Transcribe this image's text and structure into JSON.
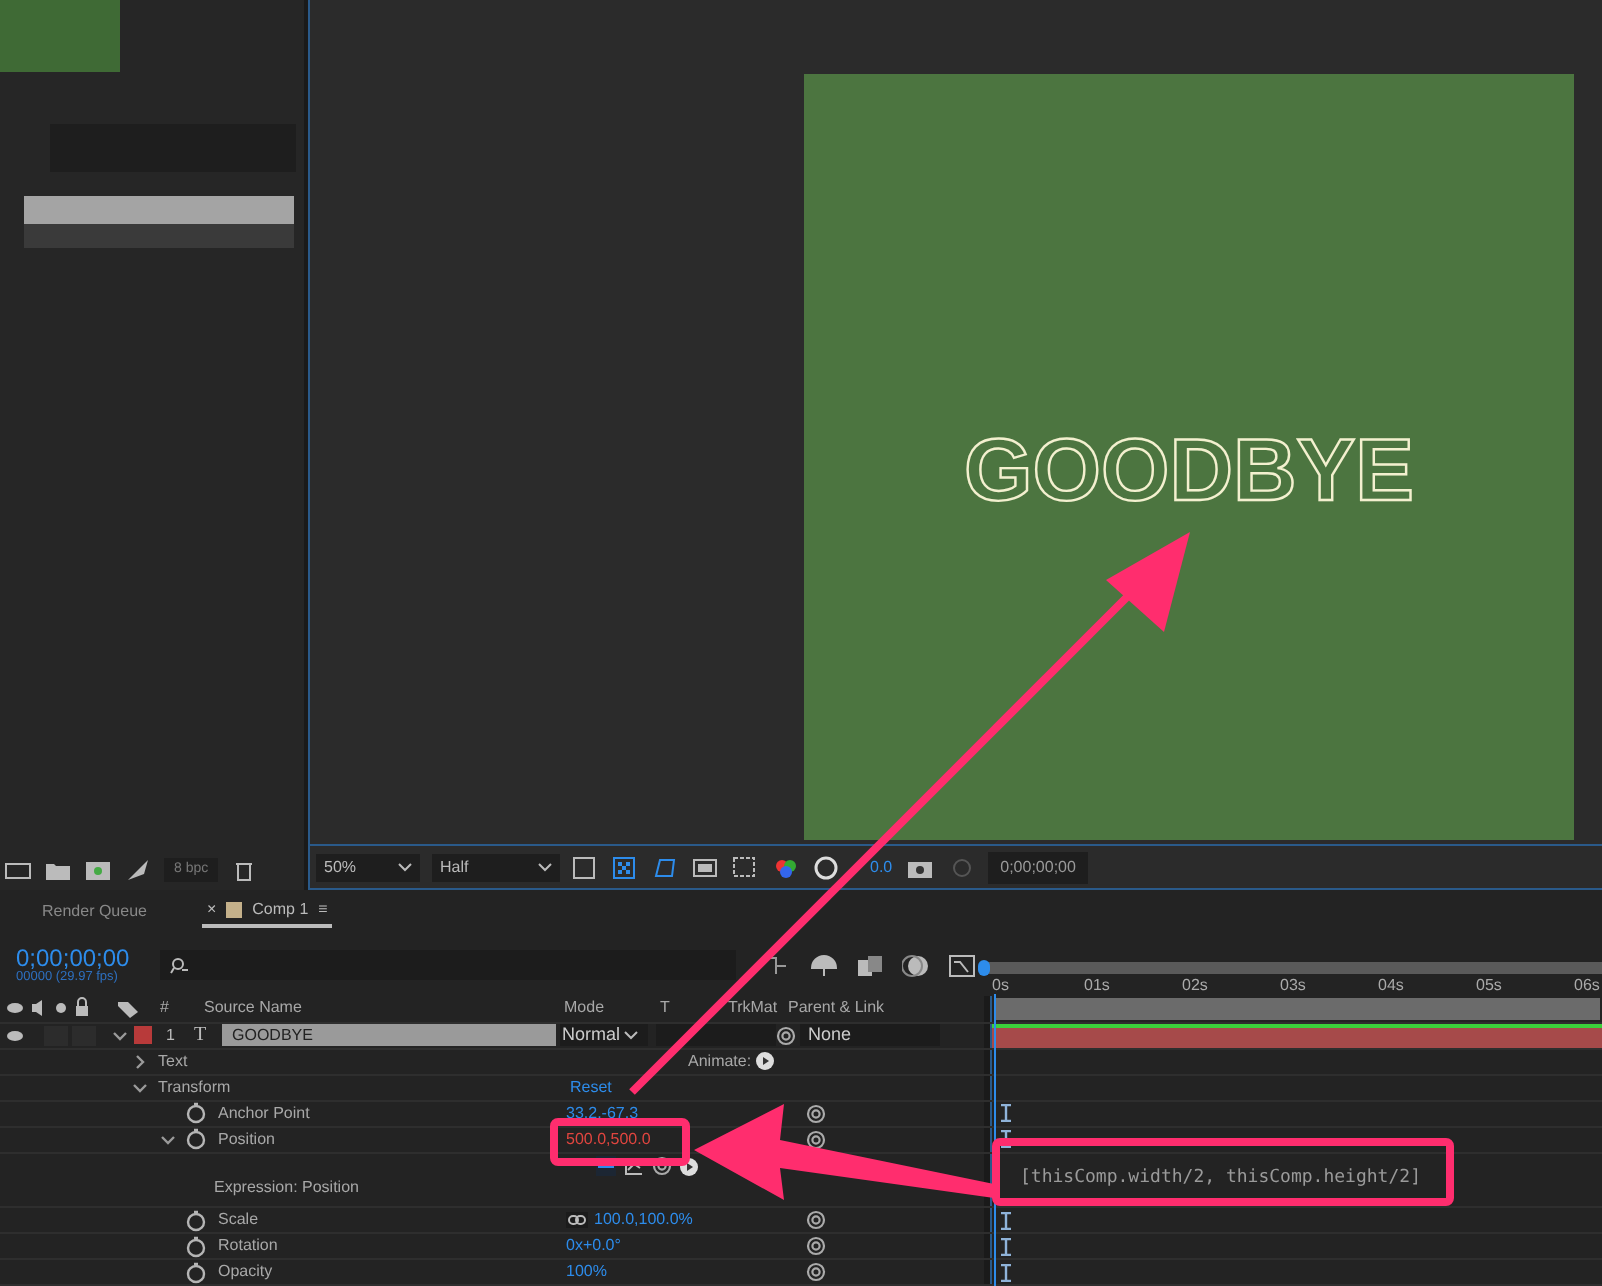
{
  "project_panel": {
    "bit_depth": "8 bpc"
  },
  "viewer": {
    "comp_text": "GOODBYE",
    "zoom": "50%",
    "resolution": "Half",
    "exposure": "0.0",
    "timecode": "0;00;00;00"
  },
  "timeline": {
    "tabs": [
      {
        "label": "Render Queue",
        "selected": false
      },
      {
        "label": "Comp 1",
        "selected": true,
        "close": "×",
        "menu": "≡",
        "color": "#c4b08a"
      }
    ],
    "current_time": "0;00;00;00",
    "frame_info": "00000 (29.97 fps)",
    "columns": [
      "#",
      "Source Name",
      "Mode",
      "T",
      "TrkMat",
      "Parent & Link"
    ],
    "ruler": [
      "0s",
      "01s",
      "02s",
      "03s",
      "04s",
      "05s",
      "06s"
    ],
    "layer": {
      "index": "1",
      "type_glyph": "T",
      "name": "GOODBYE",
      "mode": "Normal",
      "parent": "None",
      "color": "#b83a3a",
      "expanded": true
    },
    "properties": [
      {
        "kind": "group",
        "name": "Text",
        "expanded": false,
        "action": "Animate:"
      },
      {
        "kind": "group",
        "name": "Transform",
        "expanded": true,
        "action": "Reset",
        "children": [
          {
            "kind": "property",
            "name": "Anchor Point",
            "value": "33.2,-67.3",
            "has_expression": false
          },
          {
            "kind": "property",
            "name": "Position",
            "value": "500.0,500.0",
            "has_expression": true,
            "expanded": true,
            "children": [
              {
                "kind": "expression",
                "name": "Expression: Position",
                "code": "[thisComp.width/2, thisComp.height/2]"
              }
            ]
          },
          {
            "kind": "property",
            "name": "Scale",
            "value": "100.0,100.0%",
            "has_expression": false,
            "linked": true
          },
          {
            "kind": "property",
            "name": "Rotation",
            "value": "0x+0.0°",
            "has_expression": false
          },
          {
            "kind": "property",
            "name": "Opacity",
            "value": "100%",
            "has_expression": false
          }
        ]
      }
    ]
  }
}
